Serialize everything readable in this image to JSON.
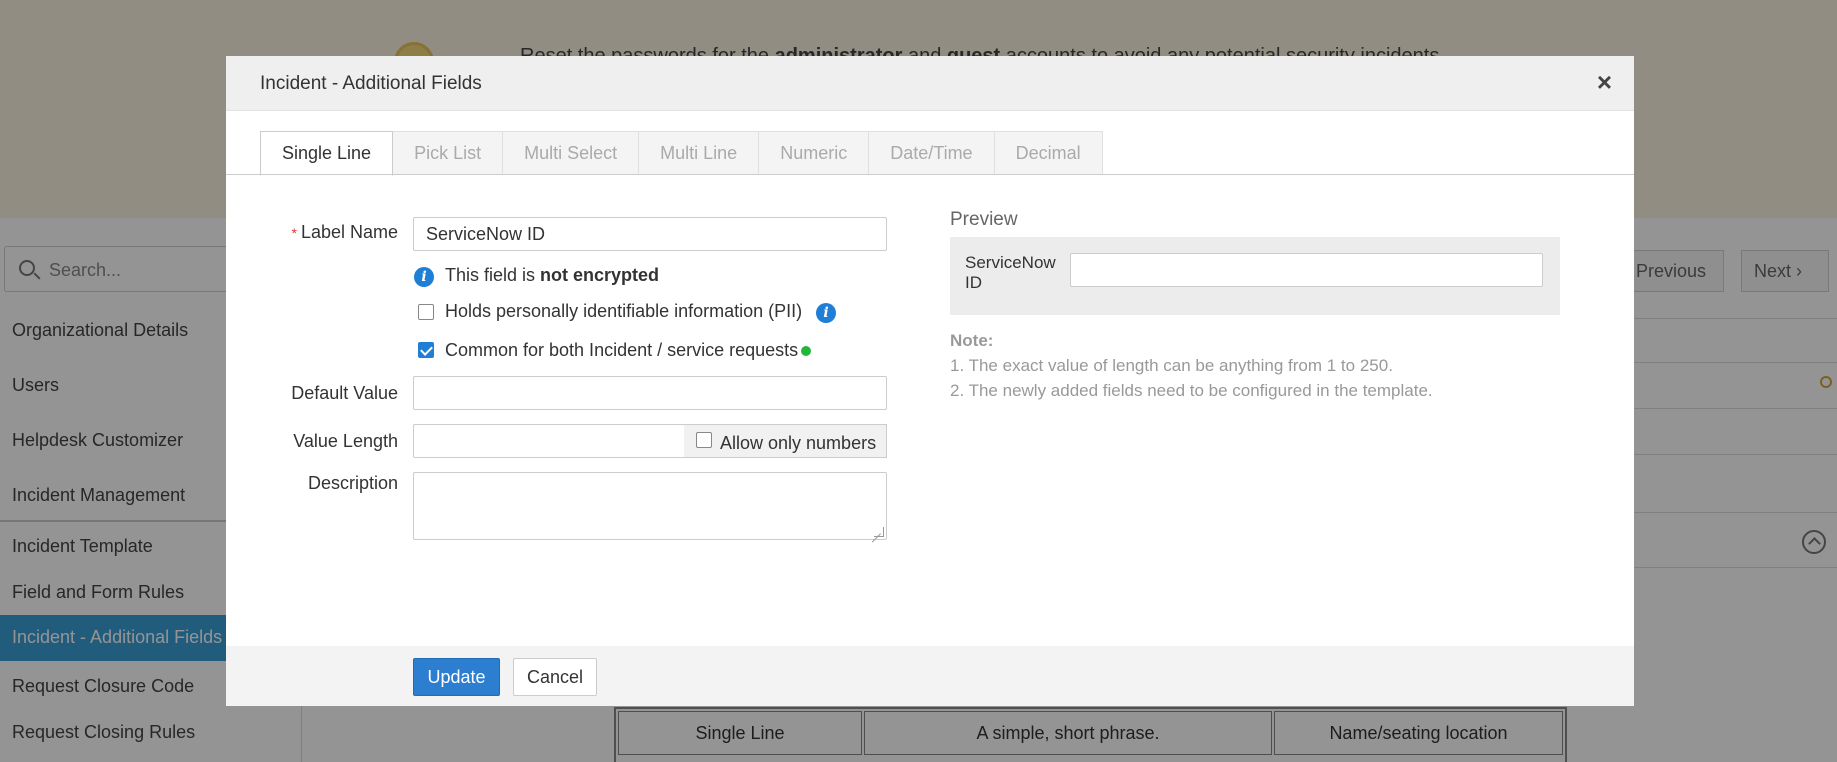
{
  "background": {
    "banner": {
      "pre": "Reset the passwords for the ",
      "b1": "administrator",
      "mid": " and ",
      "b2": "guest",
      "post": " accounts to avoid any potential security incidents."
    },
    "search_placeholder": "Search...",
    "sidebar": {
      "items": [
        "Organizational Details",
        "Users",
        "Helpdesk Customizer",
        "Incident Management",
        "Incident Template",
        "Field and Form Rules",
        "Incident - Additional Fields",
        "Request Closure Code",
        "Request Closing Rules"
      ]
    },
    "pager": {
      "previous": "Previous",
      "next": "Next"
    },
    "table_row": [
      "Single Line",
      "A simple, short phrase.",
      "Name/seating location"
    ]
  },
  "modal": {
    "title": "Incident - Additional Fields",
    "close": "×",
    "tabs": [
      "Single Line",
      "Pick List",
      "Multi Select",
      "Multi Line",
      "Numeric",
      "Date/Time",
      "Decimal"
    ],
    "form": {
      "label_name_label": "Label Name",
      "label_name_value": "ServiceNow ID",
      "encryption_prefix": "This field is ",
      "encryption_status": "not encrypted",
      "pii_label": "Holds personally identifiable information (PII)",
      "pii_checked": false,
      "common_label": "Common for both Incident / service requests",
      "common_checked": true,
      "default_value_label": "Default Value",
      "default_value": "",
      "value_length_label": "Value Length",
      "value_length": "",
      "allow_numbers_label": "Allow only numbers",
      "allow_numbers_checked": false,
      "description_label": "Description",
      "description_value": ""
    },
    "preview": {
      "title": "Preview",
      "field_label": "ServiceNow ID",
      "note_title": "Note:",
      "notes": [
        "1. The exact value of length can be anything from 1 to 250.",
        "2. The newly added fields need to be configured in the template."
      ]
    },
    "footer": {
      "update": "Update",
      "cancel": "Cancel"
    }
  },
  "colors": {
    "primary": "#2c7fd0",
    "active_sidebar": "#3a9fd6",
    "status_green": "#21b73b",
    "info": "#1f7fd6"
  }
}
